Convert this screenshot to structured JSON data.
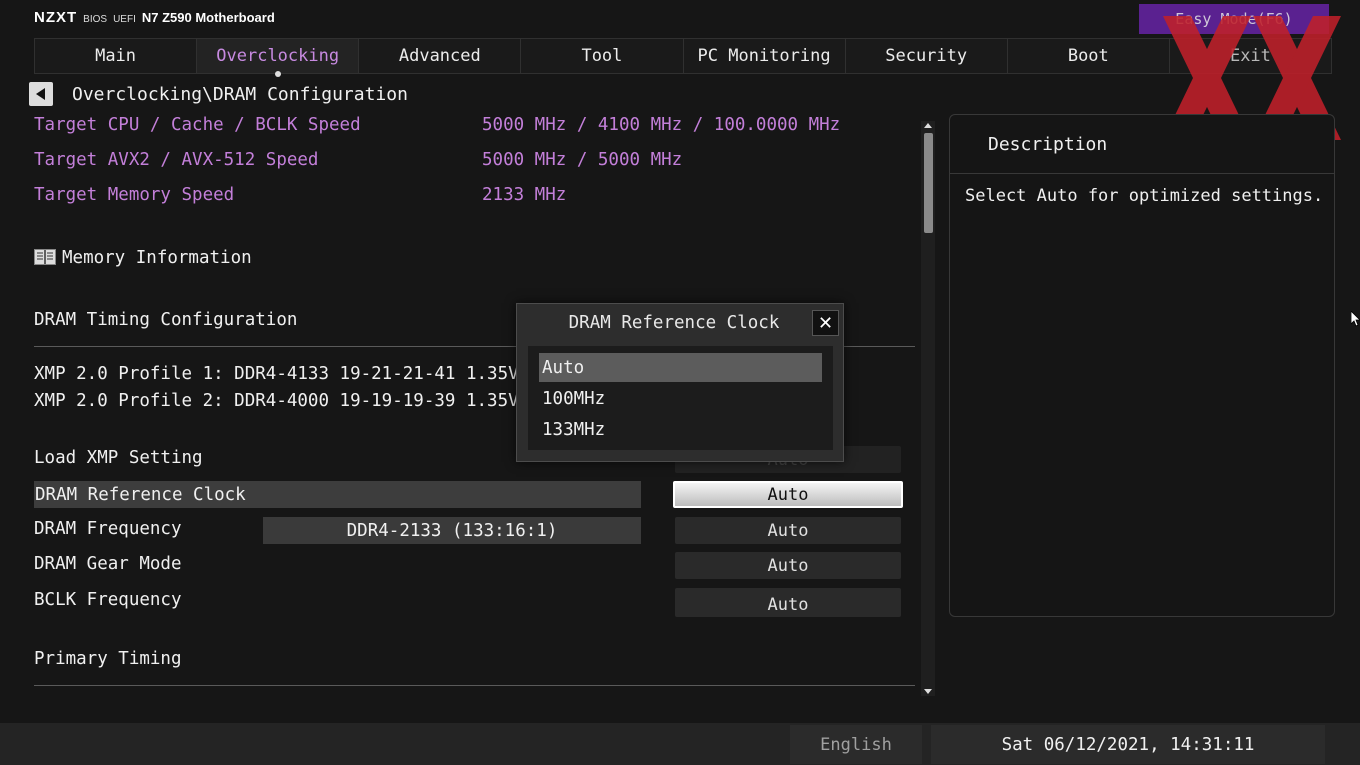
{
  "brand": {
    "logo": "NZXT",
    "bios": "BIOS",
    "uefi": "UEFI",
    "model": "N7 Z590 Motherboard"
  },
  "easy_mode_label": "Easy Mode(F6)",
  "tabs": [
    {
      "label": "Main",
      "active": false
    },
    {
      "label": "Overclocking",
      "active": true
    },
    {
      "label": "Advanced",
      "active": false
    },
    {
      "label": "Tool",
      "active": false
    },
    {
      "label": "PC Monitoring",
      "active": false
    },
    {
      "label": "Security",
      "active": false
    },
    {
      "label": "Boot",
      "active": false
    },
    {
      "label": "Exit",
      "active": false
    }
  ],
  "breadcrumb": "Overclocking\\DRAM Configuration",
  "targets": [
    {
      "label": "Target CPU / Cache / BCLK Speed",
      "value": "5000 MHz / 4100 MHz / 100.0000 MHz"
    },
    {
      "label": "Target AVX2 / AVX-512 Speed",
      "value": "5000 MHz / 5000 MHz"
    },
    {
      "label": "Target Memory Speed",
      "value": "2133 MHz"
    }
  ],
  "memory_info_label": "Memory Information",
  "dram_timing_config": "DRAM Timing Configuration",
  "xmp": [
    "XMP 2.0 Profile 1: DDR4-4133 19-21-21-41 1.35V",
    "XMP 2.0 Profile 2: DDR4-4000 19-19-19-39 1.35V"
  ],
  "settings": [
    {
      "label": "Load XMP Setting",
      "value": "Auto",
      "info": ""
    },
    {
      "label": "DRAM Reference Clock",
      "value": "Auto",
      "info": ""
    },
    {
      "label": "DRAM Frequency",
      "value": "Auto",
      "info": "DDR4-2133 (133:16:1)"
    },
    {
      "label": "DRAM Gear Mode",
      "value": "Auto",
      "info": ""
    },
    {
      "label": "BCLK Frequency",
      "value": "Auto",
      "info": ""
    }
  ],
  "primary_timing": "Primary Timing",
  "description": {
    "title": "Description",
    "text": "Select Auto for optimized settings."
  },
  "popup": {
    "title": "DRAM Reference Clock",
    "close": "✕",
    "options": [
      "Auto",
      "100MHz",
      "133MHz"
    ],
    "selected": "Auto"
  },
  "status": {
    "language": "English",
    "datetime": "Sat 06/12/2021, 14:31:11"
  },
  "colors": {
    "accent_purple": "#c37fd9",
    "easy_mode_bg": "#5a2190",
    "watermark_red": "#c0202a"
  }
}
